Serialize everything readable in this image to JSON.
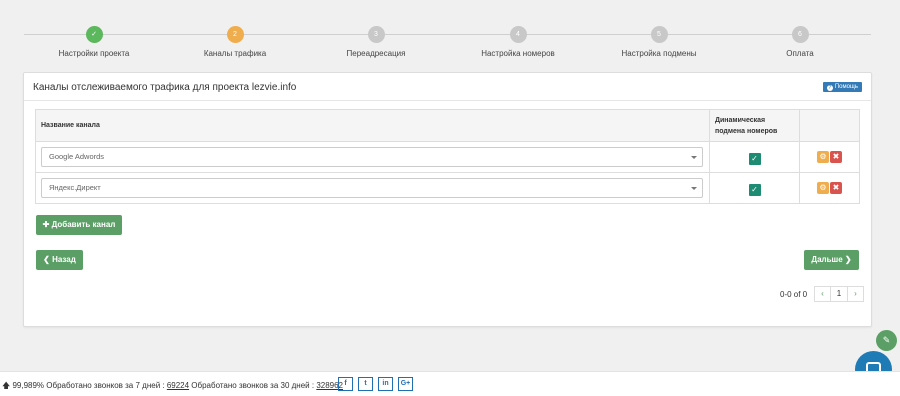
{
  "stepper": {
    "steps": [
      {
        "number": "✓",
        "label": "Настройки проекта",
        "state": "done"
      },
      {
        "number": "2",
        "label": "Каналы трафика",
        "state": "active"
      },
      {
        "number": "3",
        "label": "Переадресация",
        "state": "pending"
      },
      {
        "number": "4",
        "label": "Настройка номеров",
        "state": "pending"
      },
      {
        "number": "5",
        "label": "Настройка подмены",
        "state": "pending"
      },
      {
        "number": "6",
        "label": "Оплата",
        "state": "pending"
      }
    ]
  },
  "panel": {
    "title": "Каналы отслеживаемого трафика для проекта lezvie.info",
    "help_label": "Помощь",
    "help_icon": "?"
  },
  "table": {
    "headers": {
      "channel": "Название канала",
      "dynamic": "Динамическая подмена номеров",
      "actions": ""
    },
    "rows": [
      {
        "channel": "Google Adwords",
        "dynamic": true
      },
      {
        "channel": "Яндекс.Директ",
        "dynamic": true
      }
    ],
    "check_glyph": "✓",
    "gear_glyph": "⚙",
    "delete_glyph": "✖"
  },
  "buttons": {
    "add_channel": "✚ Добавить канал",
    "back": "❮ Назад",
    "next": "Дальше ❯"
  },
  "pager": {
    "info": "0-0 of 0",
    "prev": "‹",
    "page": "1",
    "next": "›"
  },
  "footer": {
    "arrow": "🡅",
    "text_prefix": " 99,989% Обработано звонков за 7 дней : ",
    "calls_7d": "69224",
    "text_mid": " Обработано звонков за 30 дней : ",
    "calls_30d": "328962",
    "socials": [
      "f",
      "t",
      "in",
      "G+"
    ]
  },
  "floating": {
    "note_icon": "✎"
  },
  "colors": {
    "done": "#5cb85c",
    "active": "#f0ad4e",
    "pending": "#c8c8c8",
    "primary_green": "#5b9f66",
    "help_blue": "#337ab7",
    "check_teal": "#1e8c72",
    "delete_red": "#d9534f",
    "chat_blue": "#1f7bb6"
  }
}
